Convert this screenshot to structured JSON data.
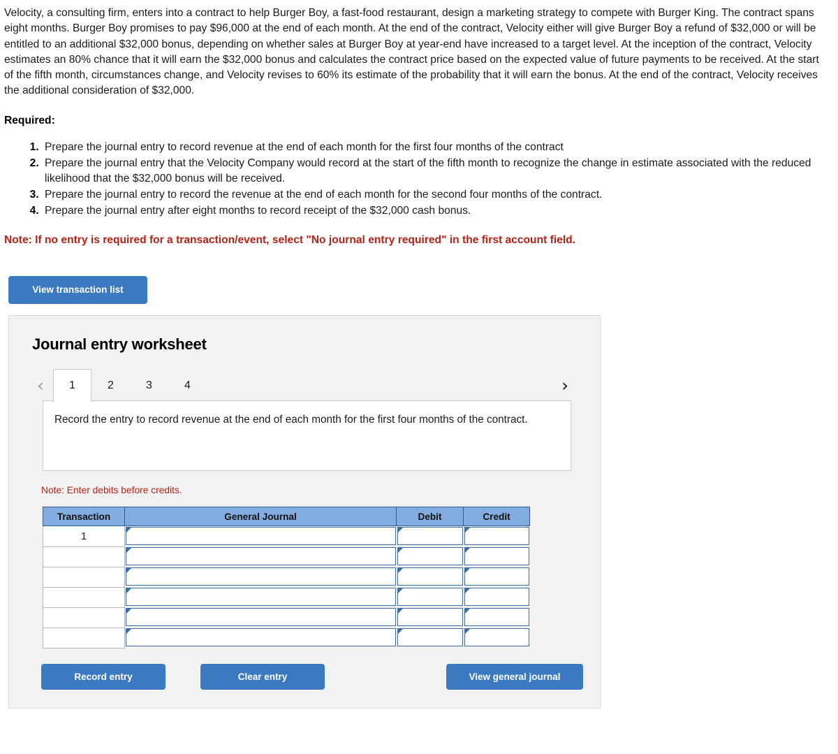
{
  "problem": {
    "paragraph": "Velocity, a consulting firm, enters into a contract to help Burger Boy, a fast-food restaurant, design a marketing strategy to compete with Burger King. The contract spans eight months. Burger Boy promises to pay $96,000 at the end of each month. At the end of the contract, Velocity either will give Burger Boy a refund of $32,000 or will be entitled to an additional $32,000 bonus, depending on whether sales at Burger Boy at year-end have increased to a target level. At the inception of the contract, Velocity estimates an 80% chance that it will earn the $32,000 bonus and calculates the contract price based on the expected value of future payments to be received. At the start of the fifth month, circumstances change, and Velocity revises to 60% its estimate of the probability that it will earn the bonus. At the end of the contract, Velocity receives the additional consideration of $32,000."
  },
  "required": {
    "heading": "Required:",
    "items": [
      "Prepare the journal entry to record revenue at the end of each month for the first four months of the contract",
      "Prepare the journal entry that the Velocity Company would record at the start of the fifth month to recognize the change in estimate associated with the reduced likelihood that the $32,000 bonus will be received.",
      "Prepare the journal entry to record the revenue at the end of each month for the second four months of the contract.",
      "Prepare the journal entry after eight months to record receipt of the $32,000 cash bonus."
    ],
    "note": "Note: If no entry is required for a transaction/event, select \"No journal entry required\" in the first account field."
  },
  "toolbar": {
    "view_transaction_list_label": "View transaction list"
  },
  "worksheet": {
    "title": "Journal entry worksheet",
    "nav": {
      "prev_icon": "‹",
      "next_icon": "›"
    },
    "tabs": [
      {
        "label": "1",
        "active": true
      },
      {
        "label": "2",
        "active": false
      },
      {
        "label": "3",
        "active": false
      },
      {
        "label": "4",
        "active": false
      }
    ],
    "description": "Record the entry to record revenue at the end of each month for the first four months of the contract.",
    "table_note": "Note: Enter debits before credits.",
    "table": {
      "columns": [
        "Transaction",
        "General Journal",
        "Debit",
        "Credit"
      ],
      "rows": [
        {
          "transaction": "1",
          "general_journal": "",
          "debit": "",
          "credit": ""
        },
        {
          "transaction": "",
          "general_journal": "",
          "debit": "",
          "credit": ""
        },
        {
          "transaction": "",
          "general_journal": "",
          "debit": "",
          "credit": ""
        },
        {
          "transaction": "",
          "general_journal": "",
          "debit": "",
          "credit": ""
        },
        {
          "transaction": "",
          "general_journal": "",
          "debit": "",
          "credit": ""
        },
        {
          "transaction": "",
          "general_journal": "",
          "debit": "",
          "credit": ""
        }
      ]
    },
    "buttons": {
      "record_entry": "Record entry",
      "clear_entry": "Clear entry",
      "view_general_journal": "View general journal"
    }
  },
  "colors": {
    "button_blue": "#3b7ac0",
    "table_header_blue": "#82abe0",
    "input_border_blue": "#3b6ea5",
    "note_red": "#b42318",
    "panel_gray": "#f2f2f2"
  }
}
